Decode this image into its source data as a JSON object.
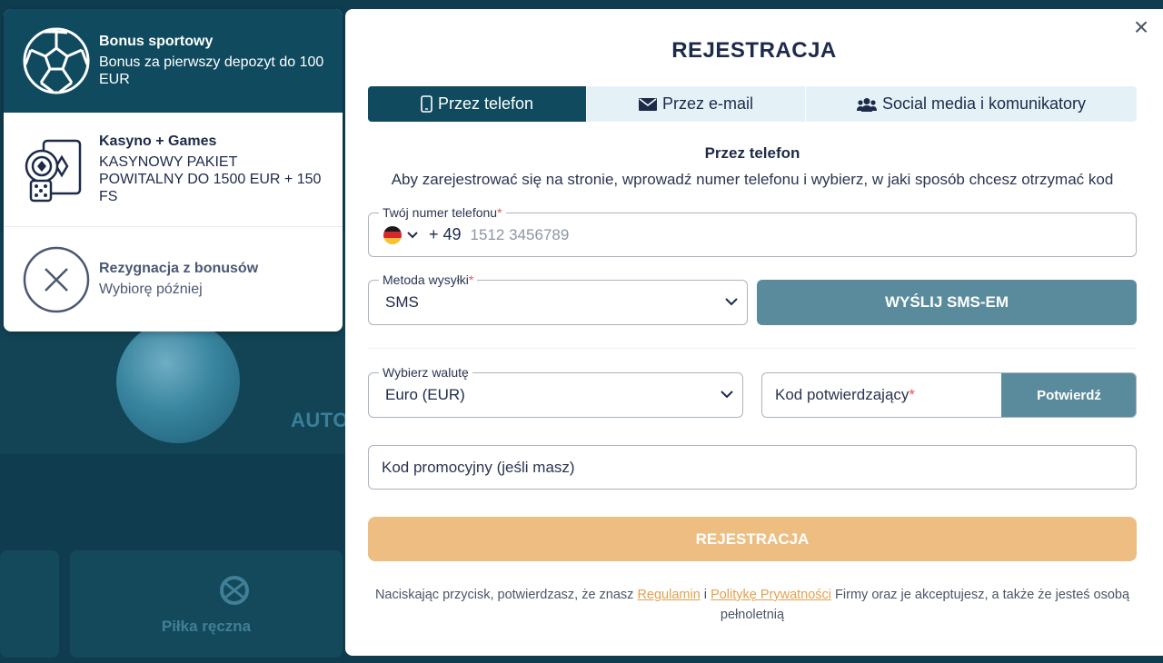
{
  "background": {
    "auto_text": "AUTO",
    "tile_label": "Piłka ręczna"
  },
  "bonuses": [
    {
      "title": "Bonus sportowy",
      "desc": "Bonus za pierwszy depozyt do 100 EUR",
      "icon": "soccer-ball-icon",
      "selected": true
    },
    {
      "title": "Kasyno + Games",
      "desc": "KASYNOWY PAKIET POWITALNY DO 1500 EUR + 150 FS",
      "icon": "casino-cards-icon",
      "selected": false
    },
    {
      "title": "Rezygnacja z bonusów",
      "desc": "Wybiorę później",
      "icon": "decline-x-icon",
      "selected": false
    }
  ],
  "modal": {
    "title": "REJESTRACJA",
    "close_symbol": "×",
    "tabs": [
      {
        "label": "Przez telefon",
        "icon": "phone-icon",
        "active": true
      },
      {
        "label": "Przez e-mail",
        "icon": "envelope-icon",
        "active": false
      },
      {
        "label": "Social media i komunikatory",
        "icon": "users-icon",
        "active": false
      }
    ],
    "section_title": "Przez telefon",
    "section_desc": "Aby zarejestrować się na stronie, wprowadź numer telefonu i wybierz, w jaki sposób chcesz otrzymać kod",
    "phone": {
      "label": "Twój numer telefonu",
      "required_mark": "*",
      "dial_code": "+ 49",
      "placeholder": "1512 3456789",
      "country_flag": "de-flag-icon"
    },
    "method": {
      "label": "Metoda wysyłki",
      "required_mark": "*",
      "value": "SMS"
    },
    "send_button": "WYŚLIJ SMS-EM",
    "currency": {
      "label": "Wybierz walutę",
      "value": "Euro (EUR)"
    },
    "code": {
      "placeholder": "Kod potwierdzający",
      "required_mark": "*",
      "confirm_button": "Potwierdź"
    },
    "promo": {
      "placeholder": "Kod promocyjny (jeśli masz)"
    },
    "register_button": "REJESTRACJA",
    "legal": {
      "prefix": "Naciskając przycisk, potwierdzasz, że znasz ",
      "terms_link": "Regulamin",
      "and": " i ",
      "privacy_link": "Politykę Prywatności",
      "suffix": " Firmy oraz je akceptujesz, a także że jesteś osobą pełnoletnią"
    }
  },
  "colors": {
    "primary": "#0f4a5e",
    "secondary_button": "#5a8b9c",
    "tab_inactive": "#e4f2f8",
    "register_button": "#edbd82",
    "link": "#e4a150"
  }
}
